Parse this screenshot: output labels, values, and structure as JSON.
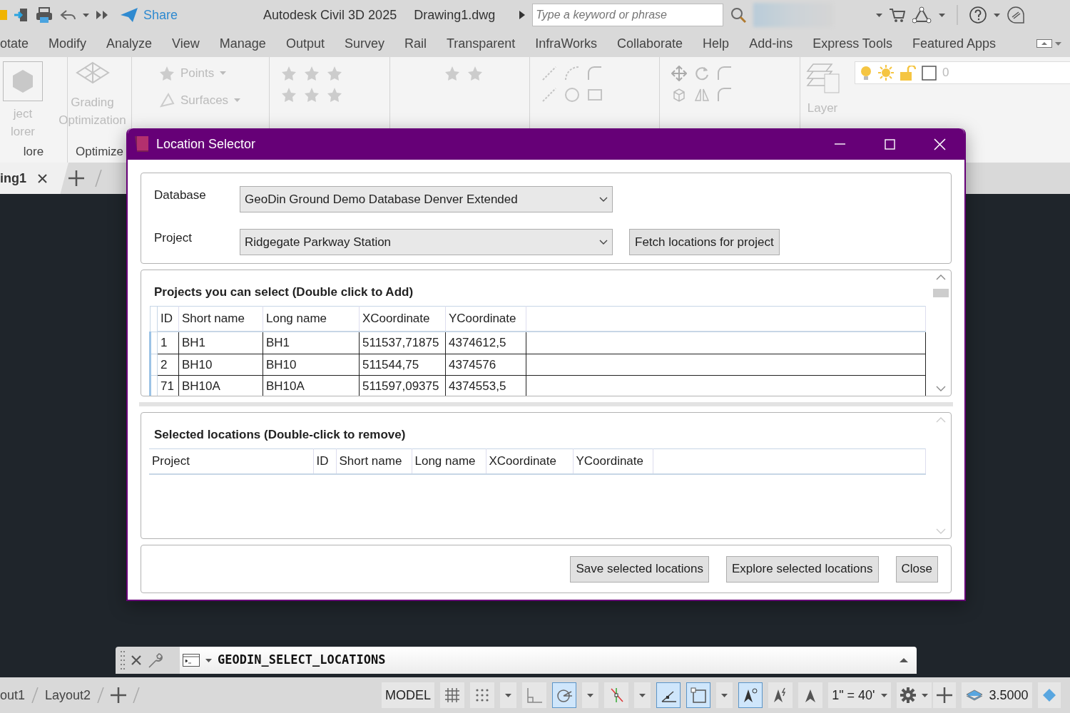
{
  "app": {
    "share": "Share",
    "title": "Autodesk Civil 3D 2025",
    "file": "Drawing1.dwg",
    "search": {
      "placeholder": "Type a keyword or phrase"
    }
  },
  "ribbon_tabs": [
    "otate",
    "Modify",
    "Analyze",
    "View",
    "Manage",
    "Output",
    "Survey",
    "Rail",
    "Transparent",
    "InfraWorks",
    "Collaborate",
    "Help",
    "Add-ins",
    "Express Tools",
    "Featured Apps"
  ],
  "ribbon": {
    "explore_button": [
      "ject",
      "lorer"
    ],
    "explore_panel": "lore",
    "grading_button": [
      "Grading",
      "Optimization"
    ],
    "optimize_panel": "Optimize",
    "dropdowns": [
      "Points",
      "Surfaces"
    ],
    "layer_button": "Layer",
    "layer_value": "0"
  },
  "doc_tabs": {
    "current": "ing1"
  },
  "dialog": {
    "title": "Location Selector",
    "fields": [
      {
        "label": "Database",
        "value": "GeoDin Ground Demo Database Denver Extended"
      },
      {
        "label": "Project",
        "value": "Ridgegate Parkway Station",
        "button": "Fetch locations for project"
      }
    ],
    "available": {
      "title": "Projects you can select (Double click to Add)",
      "columns": [
        "ID",
        "Short name",
        "Long name",
        "XCoordinate",
        "YCoordinate"
      ],
      "rows": [
        [
          "1",
          "BH1",
          "BH1",
          "511537,71875",
          "4374612,5"
        ],
        [
          "2",
          "BH10",
          "BH10",
          "511544,75",
          "4374576"
        ],
        [
          "71",
          "BH10A",
          "BH10A",
          "511597,09375",
          "4374553,5"
        ]
      ]
    },
    "selected": {
      "title": "Selected locations (Double-click to remove)",
      "columns": [
        "Project",
        "ID",
        "Short name",
        "Long name",
        "XCoordinate",
        "YCoordinate"
      ]
    },
    "buttons": [
      "Save selected locations",
      "Explore selected locations",
      "Close"
    ]
  },
  "command_line": {
    "text": "GEODIN_SELECT_LOCATIONS"
  },
  "status_bar": {
    "layout_tabs": [
      "out1",
      "Layout2"
    ],
    "model": "MODEL",
    "toggles": [
      {
        "kind": "grid",
        "on": false
      },
      {
        "kind": "snap",
        "on": false
      },
      {
        "kind": "dropdown"
      },
      {
        "kind": "ortho",
        "on": false
      },
      {
        "kind": "polar",
        "on": true
      },
      {
        "kind": "dropdown"
      },
      {
        "kind": "isodraft",
        "on": false
      },
      {
        "kind": "dropdown"
      },
      {
        "kind": "dynamic",
        "on": true
      },
      {
        "kind": "selection",
        "on": true
      },
      {
        "kind": "dropdown"
      },
      {
        "kind": "annovis",
        "on": true
      },
      {
        "kind": "autoscale",
        "on": false
      },
      {
        "kind": "annotate",
        "on": false
      }
    ],
    "scale": "1\" = 40'",
    "value": "3.5000"
  }
}
